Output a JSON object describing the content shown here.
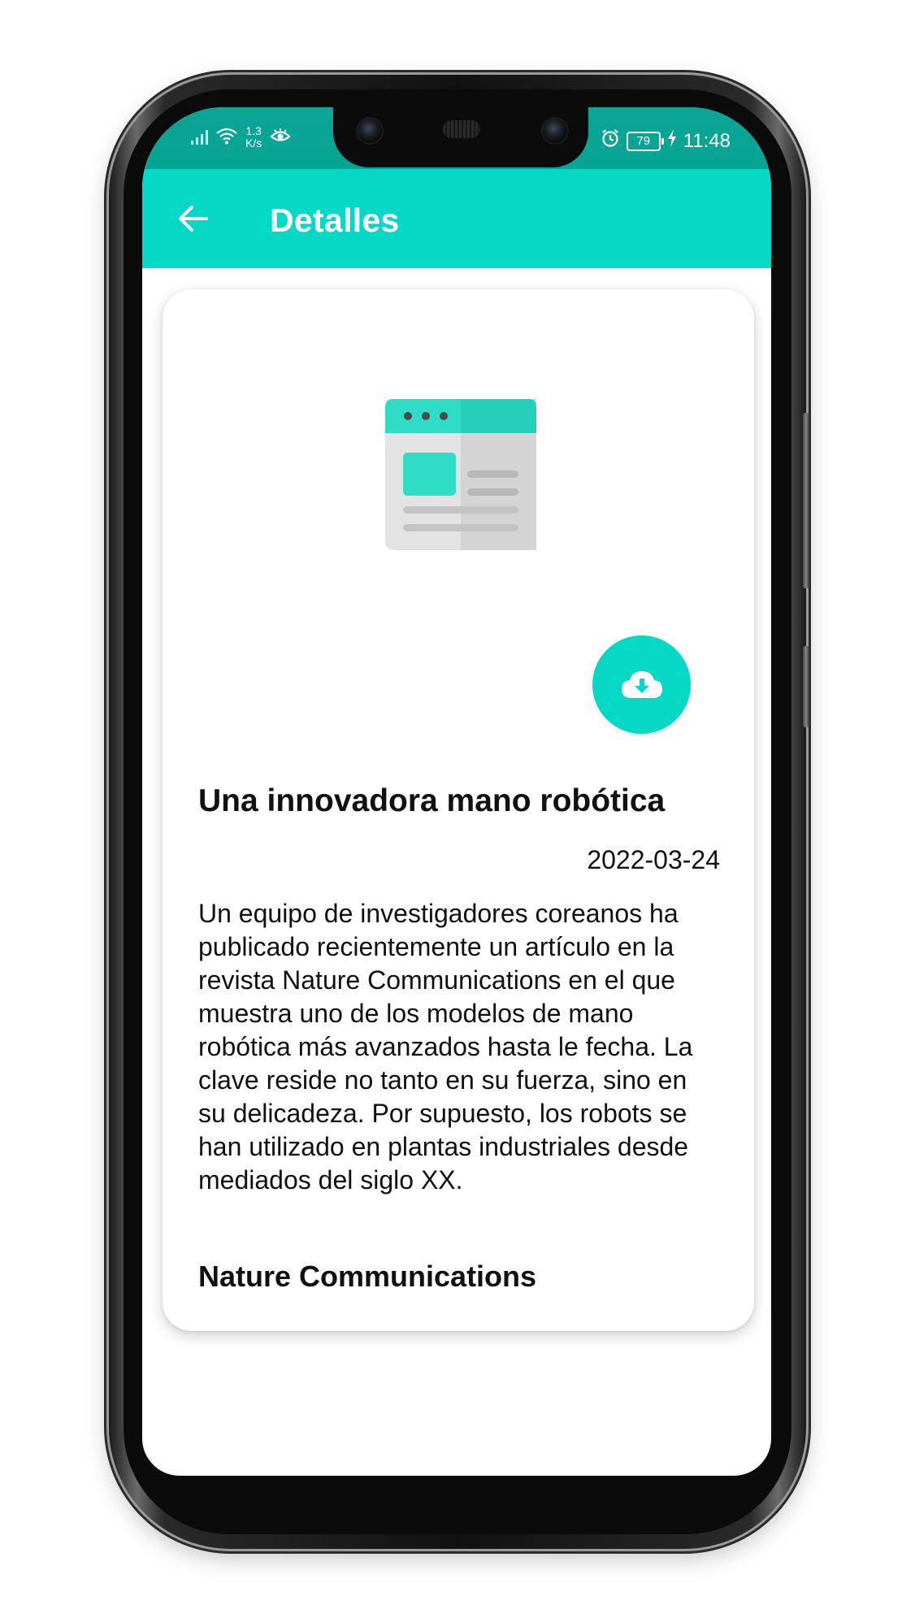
{
  "status_bar": {
    "net_speed_value": "1.3",
    "net_speed_unit": "K/s",
    "battery": "79",
    "time": "11:48"
  },
  "app_bar": {
    "title": "Detalles"
  },
  "article": {
    "title": "Una innovadora mano robótica",
    "date": "2022-03-24",
    "body": "Un equipo de investigadores coreanos ha publicado recientemente un artículo en la revista Nature Communications en el que muestra uno de los modelos de mano robótica más avanzados hasta le fecha. La clave reside no tanto en su fuerza, sino en su delicadeza. Por supuesto, los robots se han utilizado en plantas industriales desde mediados del siglo XX.",
    "source": "Nature Communications"
  },
  "icons": {
    "back": "arrow-left-icon",
    "thumbnail": "web-page-icon",
    "download": "cloud-download-icon",
    "alarm": "alarm-icon",
    "charging": "bolt-icon",
    "eye": "eye-icon",
    "wifi": "wifi-icon",
    "signal": "signal-icon"
  },
  "colors": {
    "accent": "#05d9c6",
    "status_bar": "#06a393",
    "text": "#111111"
  }
}
